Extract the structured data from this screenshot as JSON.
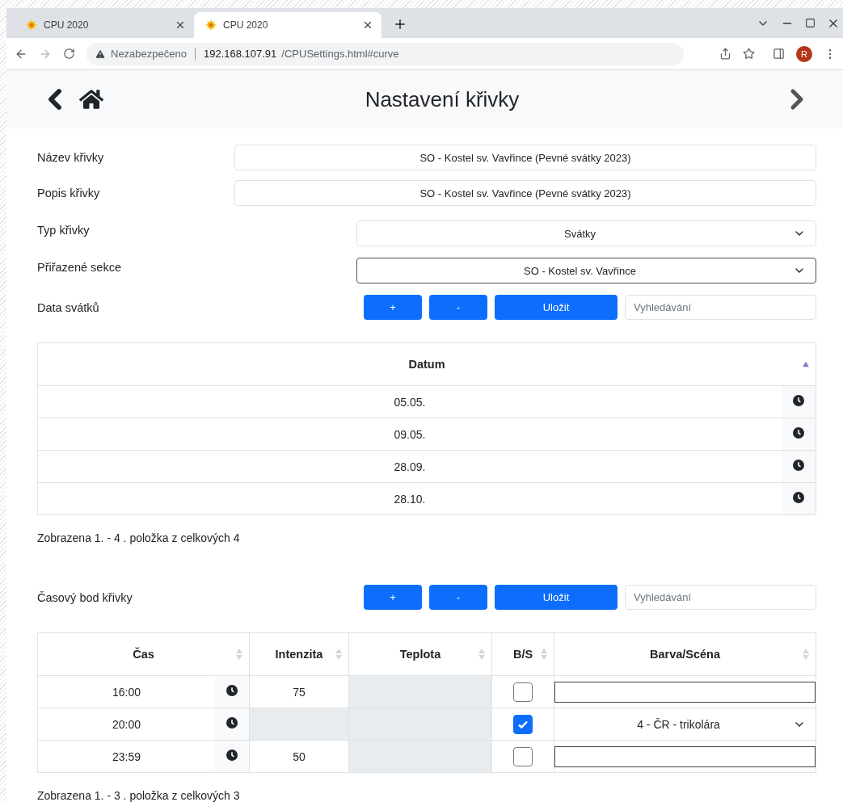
{
  "browser": {
    "tabs": [
      {
        "title": "CPU 2020",
        "selected": false
      },
      {
        "title": "CPU 2020",
        "selected": true
      }
    ],
    "security": "Nezabezpečeno",
    "url_host": "192.168.107.91",
    "url_path": "/CPUSettings.html#curve",
    "profile": "R"
  },
  "page": {
    "title": "Nastavení křivky"
  },
  "form": [
    {
      "kind": "input",
      "label": "Název křivky",
      "value": "SO - Kostel sv. Vavřince (Pevné svátky 2023)"
    },
    {
      "kind": "input",
      "label": "Popis křivky",
      "value": "SO - Kostel sv. Vavřince (Pevné svátky 2023)"
    },
    {
      "kind": "select",
      "label": "Typ křivky",
      "value": "Svátky",
      "focused": false
    },
    {
      "kind": "select",
      "label": "Přiřazené sekce",
      "value": "SO - Kostel sv. Vavřince",
      "focused": true
    }
  ],
  "holidays": {
    "label": "Data svátků",
    "buttons": [
      "+",
      "-",
      "Uložit"
    ],
    "search_placeholder": "Vyhledávání",
    "column": {
      "label": "Datum",
      "sorted": true
    },
    "rows": [
      "05.05.",
      "09.05.",
      "28.09.",
      "28.10."
    ],
    "footer": "Zobrazena 1. - 4 . položka z celkových 4"
  },
  "points": {
    "label": "Časový bod křivky",
    "buttons": [
      "+",
      "-",
      "Uložit"
    ],
    "search_placeholder": "Vyhledávání",
    "columns": [
      {
        "label": "Čas",
        "sorted": false
      },
      {
        "label": "Intenzita",
        "sorted": false
      },
      {
        "label": "Teplota",
        "sorted": false
      },
      {
        "label": "B/S",
        "sorted": false
      },
      {
        "label": "Barva/Scéna",
        "sorted": false
      }
    ],
    "rows": [
      {
        "time": "16:00",
        "intensity": "75",
        "bs_checked": false,
        "scene": {
          "kind": "input"
        }
      },
      {
        "time": "20:00",
        "bs_checked": true,
        "scene": {
          "kind": "select",
          "value": "4 - ČR - trikolára"
        }
      },
      {
        "time": "23:59",
        "intensity": "50",
        "bs_checked": false,
        "scene": {
          "kind": "input"
        }
      }
    ],
    "footer": "Zobrazena 1. - 3 . položka z celkových 3"
  }
}
